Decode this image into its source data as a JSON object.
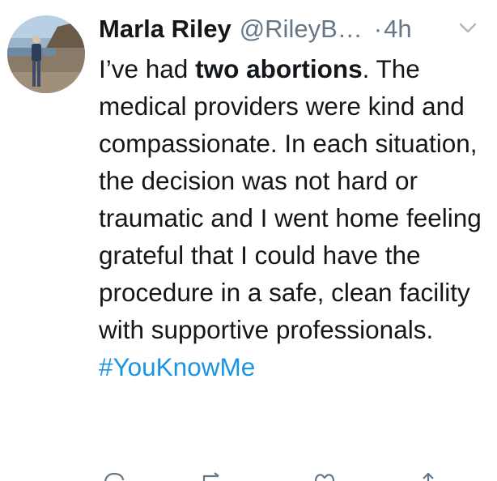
{
  "tweet": {
    "author": {
      "display_name": "Marla Riley",
      "handle": "@RileyB…"
    },
    "separator": "·",
    "timestamp": "4h",
    "text": {
      "part1": "I’ve had ",
      "bold": "two abortions",
      "part2": ". The medical providers were kind and compassionate. In each situation, the decision was not hard or traumatic and I went home feeling grateful that I could have the procedure in a safe, clean facility with supportive professionals."
    },
    "hashtag": "#YouKnowMe",
    "menu_icon": "chevron-down-icon",
    "action_icons": [
      "reply-icon",
      "retweet-icon",
      "like-icon",
      "share-icon"
    ]
  },
  "colors": {
    "text": "#14171a",
    "secondary": "#657786",
    "link": "#1b95e0",
    "background": "#ffffff"
  }
}
